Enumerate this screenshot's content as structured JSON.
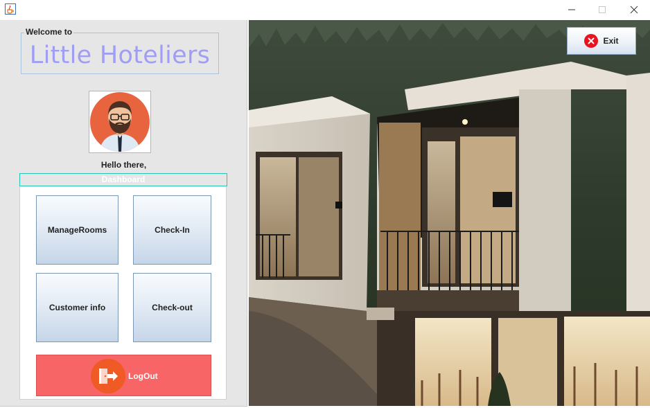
{
  "window": {
    "title_icon": "java-cup-icon",
    "controls": [
      "minimize-icon",
      "maximize-icon",
      "close-icon"
    ]
  },
  "sidebar": {
    "welcome_label": "Welcome to",
    "app_name": "Little Hoteliers",
    "greeting": "Hello there,",
    "dashboard_label": "Dashboard",
    "tiles": {
      "manage_rooms": "ManageRooms",
      "check_in": "Check-In",
      "customer_info": "Customer info",
      "check_out": "Check-out"
    },
    "logout_label": "LogOut"
  },
  "main": {
    "exit_label": "Exit"
  },
  "colors": {
    "app_name": "#a09ef4",
    "logout_bg": "#f86566",
    "logout_icon_bg": "#f05a24",
    "exit_icon": "#e8131f",
    "dashboard_border": "#27c3bb"
  }
}
